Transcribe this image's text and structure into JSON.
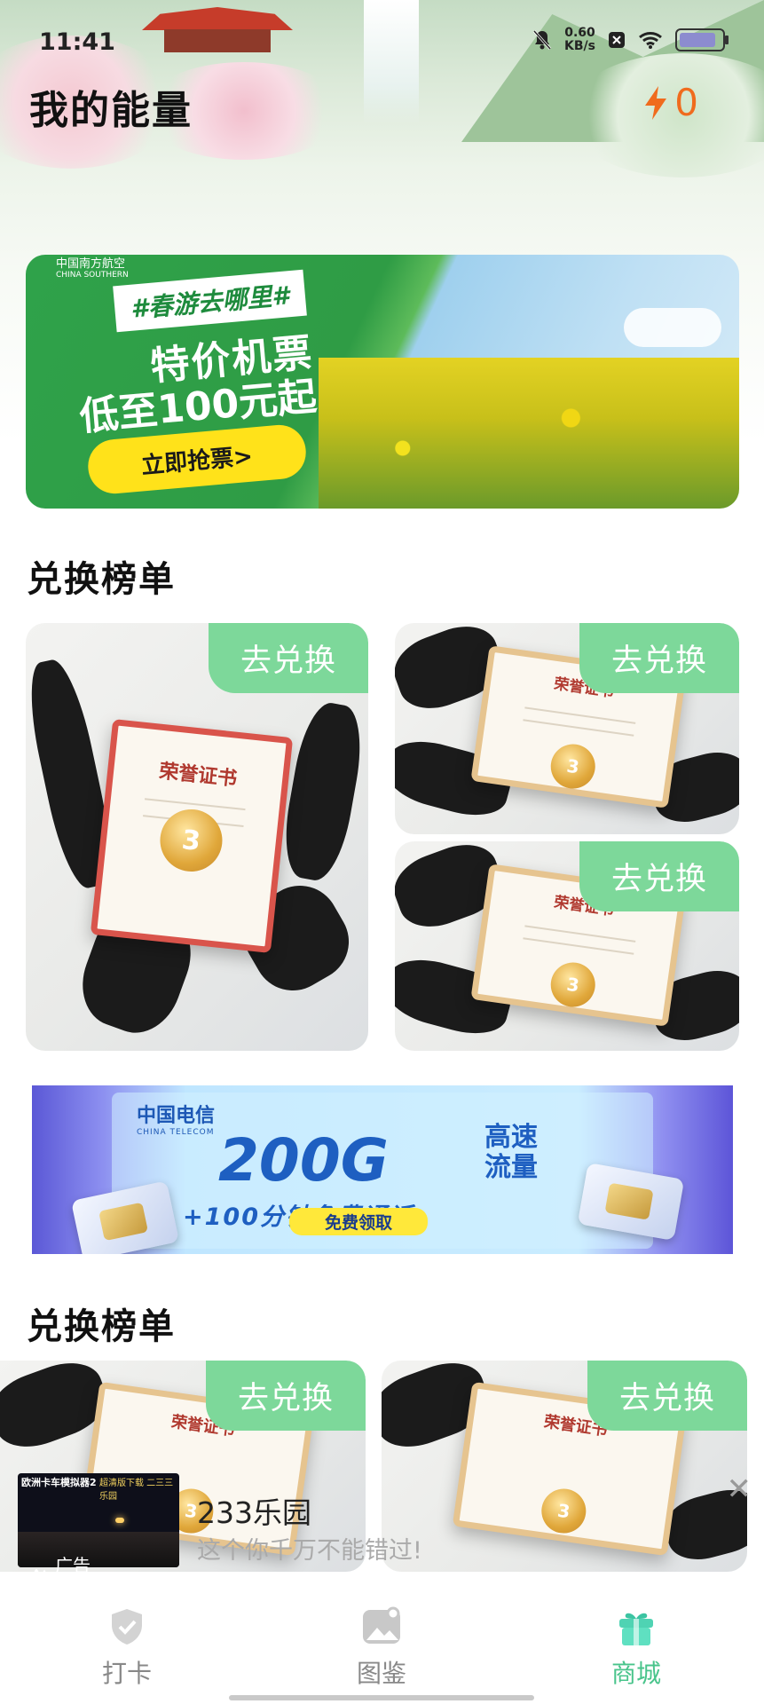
{
  "status_bar": {
    "time": "11:41",
    "net_speed_value": "0.60",
    "net_speed_unit": "KB/s",
    "battery_level": 0.9
  },
  "header": {
    "title": "我的能量",
    "energy_count": "0"
  },
  "air_banner": {
    "logo_cn": "中国南方航空",
    "logo_en": "CHINA SOUTHERN",
    "tag": "#春游去哪里#",
    "title": "特价机票",
    "subtitle": "低至100元起",
    "cta": "立即抢票>"
  },
  "section1": {
    "title": "兑换榜单",
    "cards": [
      {
        "cert_title": "荣誉证书",
        "medal": "3",
        "button": "去兑换"
      },
      {
        "cert_title": "荣誉证书",
        "medal": "3",
        "button": "去兑换"
      },
      {
        "cert_title": "荣誉证书",
        "medal": "3",
        "button": "去兑换"
      }
    ]
  },
  "telecom_banner": {
    "logo_cn": "中国电信",
    "logo_en": "CHINA TELECOM",
    "headline": "200G",
    "headline_side_1": "高速",
    "headline_side_2": "流量",
    "line": "+100分钟免费通话",
    "cta": "免费领取"
  },
  "section2": {
    "title": "兑换榜单",
    "cards": [
      {
        "cert_title": "荣誉证书",
        "medal": "3",
        "button": "去兑换"
      },
      {
        "cert_title": "荣誉证书",
        "medal": "3",
        "button": "去兑换"
      }
    ]
  },
  "ad": {
    "label": "广告",
    "name": "233乐园",
    "desc": "这个你千万不能错过!",
    "thumb_title": "欧洲卡车模拟器2",
    "thumb_sub": "超清版下载 二三三乐园"
  },
  "bottom_nav": [
    {
      "label": "打卡",
      "icon": "shield-check-icon"
    },
    {
      "label": "图鉴",
      "icon": "picture-icon"
    },
    {
      "label": "商城",
      "icon": "gift-icon",
      "active": true
    }
  ],
  "colors": {
    "accent_green": "#7dd89a",
    "nav_active": "#49c48b",
    "energy_orange": "#f06b1d"
  }
}
